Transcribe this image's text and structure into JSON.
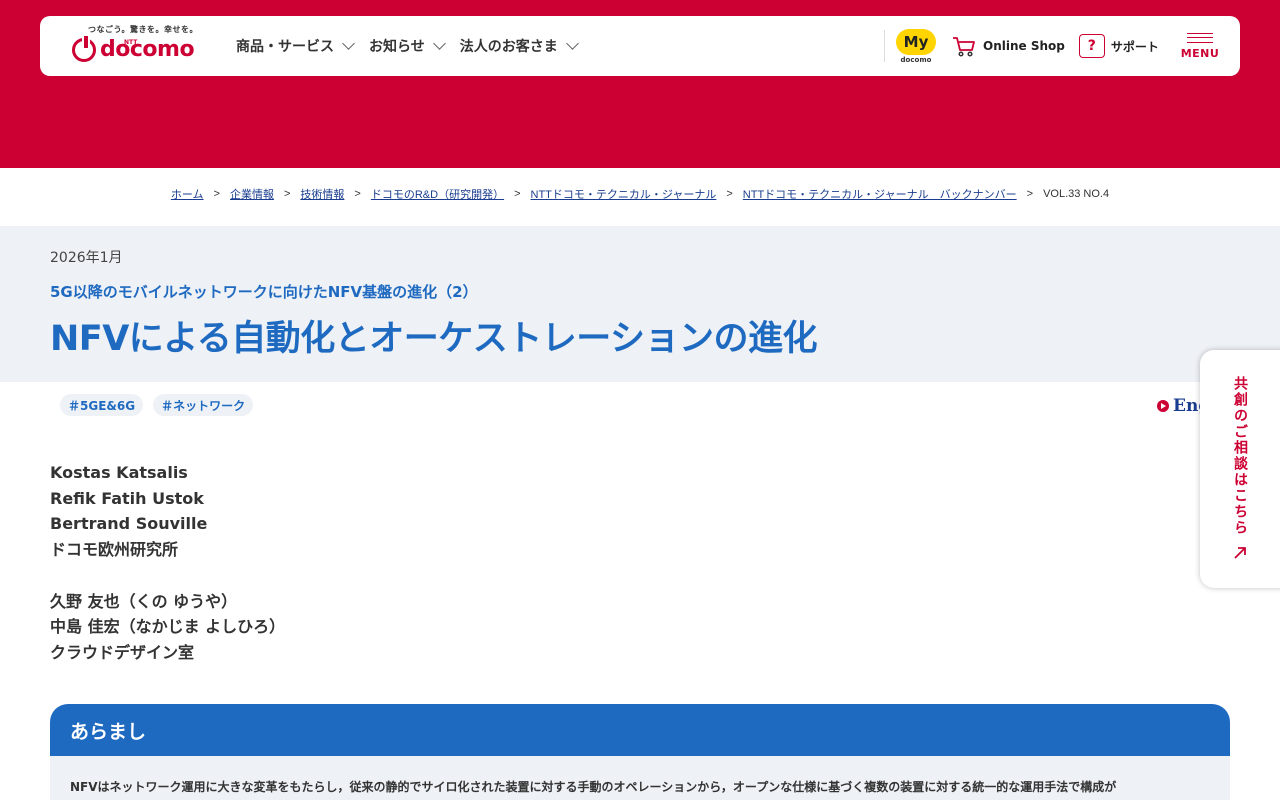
{
  "header": {
    "logo_tagline": "つなごう。驚きを。幸せを。",
    "logo_ntt": "NTT",
    "logo_word": "docomo",
    "nav": [
      {
        "label": "商品・サービス"
      },
      {
        "label": "お知らせ"
      },
      {
        "label": "法人のお客さま"
      }
    ],
    "my_badge": "My",
    "my_sub": "docomo",
    "online_shop": "Online Shop",
    "support": "サポート",
    "menu": "MENU"
  },
  "breadcrumb": {
    "items": [
      "ホーム",
      "企業情報",
      "技術情報",
      "ドコモのR&D（研究開発）",
      "NTTドコモ・テクニカル・ジャーナル",
      "NTTドコモ・テクニカル・ジャーナル　バックナンバー"
    ],
    "separator": ">",
    "current": "VOL.33 NO.4"
  },
  "article": {
    "date": "2026年1月",
    "subtitle": "5G以降のモバイルネットワークに向けたNFV基盤の進化（2）",
    "title": "NFVによる自動化とオーケストレーションの進化",
    "tags": [
      "＃5GE&6G",
      "＃ネットワーク"
    ],
    "english_link": "English"
  },
  "authors": {
    "group1": [
      "Kostas Katsalis",
      "Refik Fatih Ustok",
      "Bertrand Souville",
      "ドコモ欧州研究所"
    ],
    "group2": [
      "久野 友也（くの ゆうや）",
      "中島 佳宏（なかじま よしひろ）",
      "クラウドデザイン室"
    ]
  },
  "side_tab": {
    "label": "共創のご相談はこちら"
  },
  "abstract": {
    "heading": "あらまし",
    "text": "NFVはネットワーク運用に大きな変革をもたらし，従来の静的でサイロ化された装置に対する手動のオペレーションから，オープンな仕様に基づく複数の装置に対する統一的な運用手法で構成が"
  },
  "colors": {
    "brand_red": "#cc0033",
    "accent_blue": "#1f6ac1",
    "band_gray": "#eef1f5",
    "badge_yellow": "#ffd400"
  }
}
